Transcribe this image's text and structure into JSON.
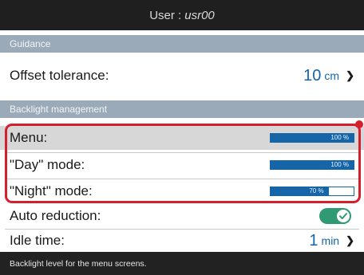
{
  "header": {
    "user_label": "User :",
    "user_value": "usr00"
  },
  "sections": {
    "guidance": "Guidance",
    "backlight": "Backlight management"
  },
  "guidance": {
    "offset": {
      "label": "Offset tolerance:",
      "value": "10",
      "unit": "cm"
    }
  },
  "backlight": {
    "menu": {
      "label": "Menu:",
      "percent_text": "100 %",
      "level": 100
    },
    "day": {
      "label": "\"Day\" mode:",
      "percent_text": "100 %",
      "level": 100
    },
    "night": {
      "label": "\"Night\" mode:",
      "percent_text": "70 %",
      "level": 70
    },
    "auto_reduction": {
      "label": "Auto reduction:",
      "enabled": true
    },
    "idle_time": {
      "label": "Idle time:",
      "value": "1",
      "unit": "min"
    }
  },
  "status": {
    "hint": "Backlight level for the menu screens."
  },
  "colors": {
    "accent": "#1565a8",
    "highlight": "#d61f2d",
    "toggle_on": "#2f9a73",
    "section_bg": "#9aaab8"
  },
  "icons": {
    "chevron": "chevron-right-icon",
    "check": "check-icon"
  }
}
